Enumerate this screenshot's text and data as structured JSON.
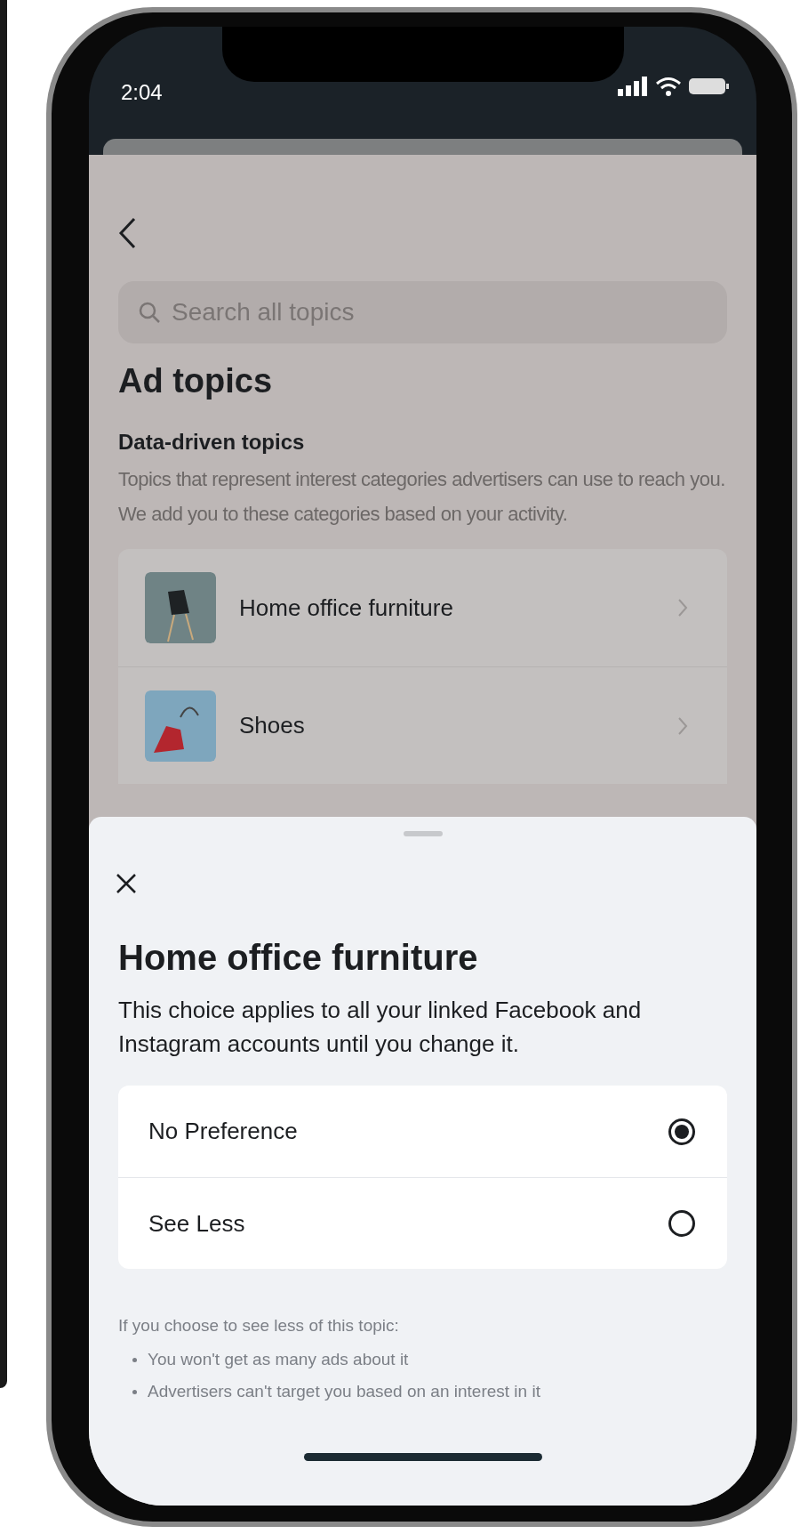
{
  "status_bar": {
    "time": "2:04"
  },
  "background": {
    "search": {
      "placeholder": "Search all topics"
    },
    "title": "Ad topics",
    "section": {
      "title": "Data-driven topics",
      "description": "Topics that represent interest categories advertisers can use to reach you. We add you to these categories based on your activity."
    },
    "topics": [
      {
        "label": "Home office furniture"
      },
      {
        "label": "Shoes"
      }
    ]
  },
  "sheet": {
    "title": "Home office furniture",
    "description": "This choice applies to all your linked Facebook and Instagram accounts until you change it.",
    "options": [
      {
        "label": "No Preference",
        "selected": true
      },
      {
        "label": "See Less",
        "selected": false
      }
    ],
    "note": {
      "intro": "If you choose to see less of this topic:",
      "points": [
        "You won't get as many ads about it",
        "Advertisers can't target you based on an interest in it"
      ]
    }
  }
}
